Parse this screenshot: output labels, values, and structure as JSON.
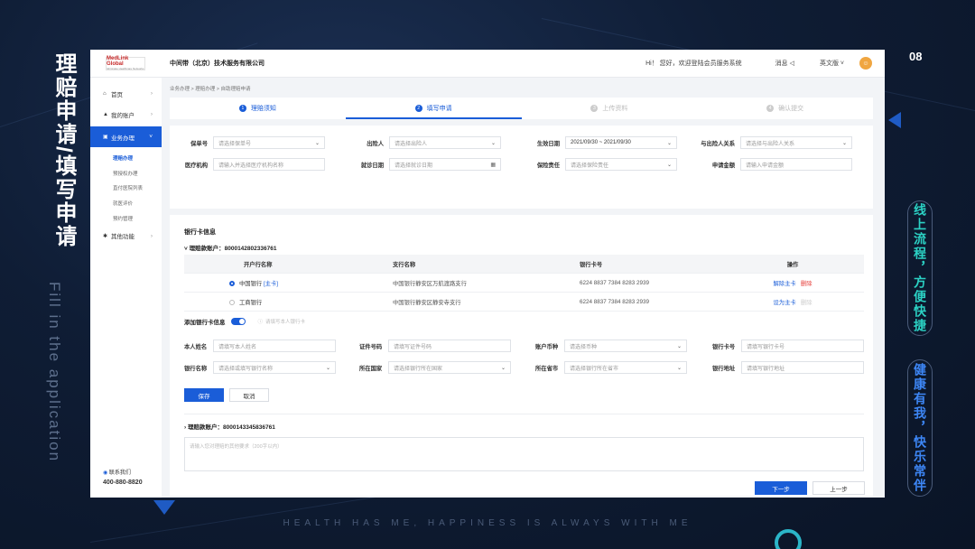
{
  "slide": {
    "title_lines": [
      "理",
      "赔",
      "申",
      "请",
      "/",
      "填",
      "写",
      "申",
      "请"
    ],
    "subtitle_en": "Fill in the application",
    "page_number": "08",
    "right_tag_1": "线上流程，方便快捷",
    "right_tag_2": "健康有我，快乐常伴",
    "footer": "HEALTH HAS ME, HAPPINESS IS ALWAYS WITH ME",
    "accent_color": "#2bb5c8"
  },
  "topbar": {
    "logo_text": "MedLink Global",
    "logo_sub": "Eliminate Healthcare Networks",
    "company": "中间带（北京）技术服务有限公司",
    "welcome": "Hi！ 您好，欢迎登陆会员服务系统",
    "messages": "消息 ◁",
    "language": "英文版 ˅",
    "avatar_icon": "user-avatar-icon"
  },
  "sidebar": {
    "items": [
      {
        "icon": "⌂",
        "label": "首页"
      },
      {
        "icon": "▲",
        "label": "我的账户"
      },
      {
        "icon": "▣",
        "label": "业务办理"
      }
    ],
    "sub_items": [
      "理赔办理",
      "预授权办理",
      "直付医院列表",
      "就医评价",
      "预约管理"
    ],
    "other": {
      "icon": "✱",
      "label": "其他功能"
    },
    "contact_label": "联系我们",
    "phone": "400-880-8820"
  },
  "breadcrumb": "业务办理 > 理赔办理 > 自助理赔申请",
  "steps": [
    {
      "num": "1",
      "label": "理赔须知"
    },
    {
      "num": "2",
      "label": "填写申请"
    },
    {
      "num": "3",
      "label": "上传资料"
    },
    {
      "num": "4",
      "label": "确认提交"
    }
  ],
  "form1": {
    "policy_no": {
      "label": "保单号",
      "placeholder": "请选择保单号"
    },
    "insured": {
      "label": "出险人",
      "placeholder": "请选择出险人"
    },
    "effective_date": {
      "label": "生效日期",
      "value": "2021/09/30 ~ 2021/09/30"
    },
    "relation": {
      "label": "与出险人关系",
      "placeholder": "请选择与出险人关系"
    },
    "institution": {
      "label": "医疗机构",
      "placeholder": "请输入并选择医疗机构名称"
    },
    "visit_date": {
      "label": "就诊日期",
      "placeholder": "请选择就诊日期"
    },
    "coverage": {
      "label": "保险责任",
      "placeholder": "请选择保险责任"
    },
    "amount": {
      "label": "申请金额",
      "placeholder": "请输入申请金额"
    }
  },
  "bank": {
    "section_title": "银行卡信息",
    "account1": "理赔款账户：8000142802336761",
    "columns": [
      "开户行名称",
      "支行名称",
      "银行卡号",
      "操作"
    ],
    "rows": [
      {
        "bank": "中国银行",
        "tag": "[主卡]",
        "branch": "中国银行静安区万航渡路支行",
        "card": "6224 8837 7384 8283 2939",
        "op1": "解除主卡",
        "op2": "删除"
      },
      {
        "bank": "工商银行",
        "tag": "",
        "branch": "中国银行静安区静安寺支行",
        "card": "6224 8837 7384 8283 2939",
        "op1": "设为主卡",
        "op2": "删除"
      }
    ],
    "add_label": "添加银行卡信息",
    "add_hint": "请填写本人银行卡",
    "fields": {
      "name": {
        "label": "本人姓名",
        "placeholder": "请填写本人姓名"
      },
      "id_no": {
        "label": "证件号码",
        "placeholder": "请填写证件号码"
      },
      "currency": {
        "label": "账户币种",
        "placeholder": "请选择币种"
      },
      "card_no": {
        "label": "银行卡号",
        "placeholder": "请填写银行卡号"
      },
      "bank_name": {
        "label": "银行名称",
        "placeholder": "请选择或填写银行名称"
      },
      "country": {
        "label": "所在国家",
        "placeholder": "请选择银行所在国家"
      },
      "province": {
        "label": "所在省市",
        "placeholder": "请选择银行所在省市"
      },
      "address": {
        "label": "银行地址",
        "placeholder": "请填写银行地址"
      }
    },
    "save": "保存",
    "cancel": "取消",
    "account2": "理赔款账户：8000143345836761",
    "remark_placeholder": "请输入您对理赔的其他要求（200字以内）"
  },
  "nav_buttons": {
    "next": "下一步",
    "prev": "上一步"
  }
}
